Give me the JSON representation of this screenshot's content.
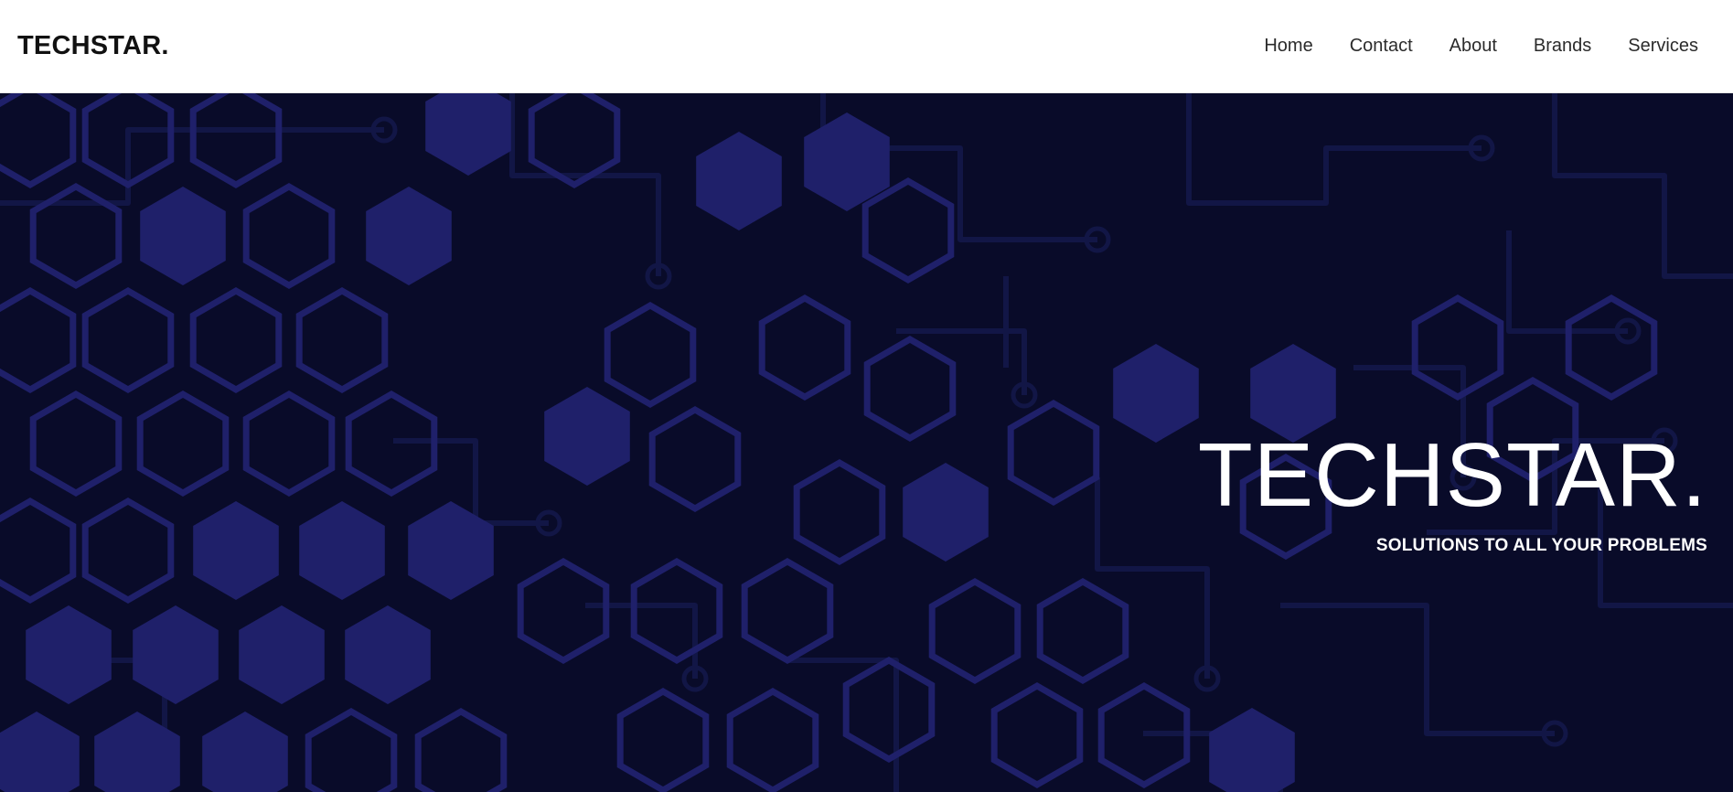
{
  "navbar": {
    "brand": "TECHSTAR.",
    "links": [
      {
        "label": "Home"
      },
      {
        "label": "Contact"
      },
      {
        "label": "About"
      },
      {
        "label": "Brands"
      },
      {
        "label": "Services"
      }
    ]
  },
  "hero": {
    "title": "TECHSTAR.",
    "subtitle": "SOLUTIONS TO ALL YOUR PROBLEMS"
  },
  "colors": {
    "hero_background": "#090b29",
    "hex_fill": "#1f206a",
    "hex_outline": "#1f206a",
    "circuit": "#121646",
    "text_on_hero": "#ffffff",
    "navbar_background": "#ffffff"
  }
}
